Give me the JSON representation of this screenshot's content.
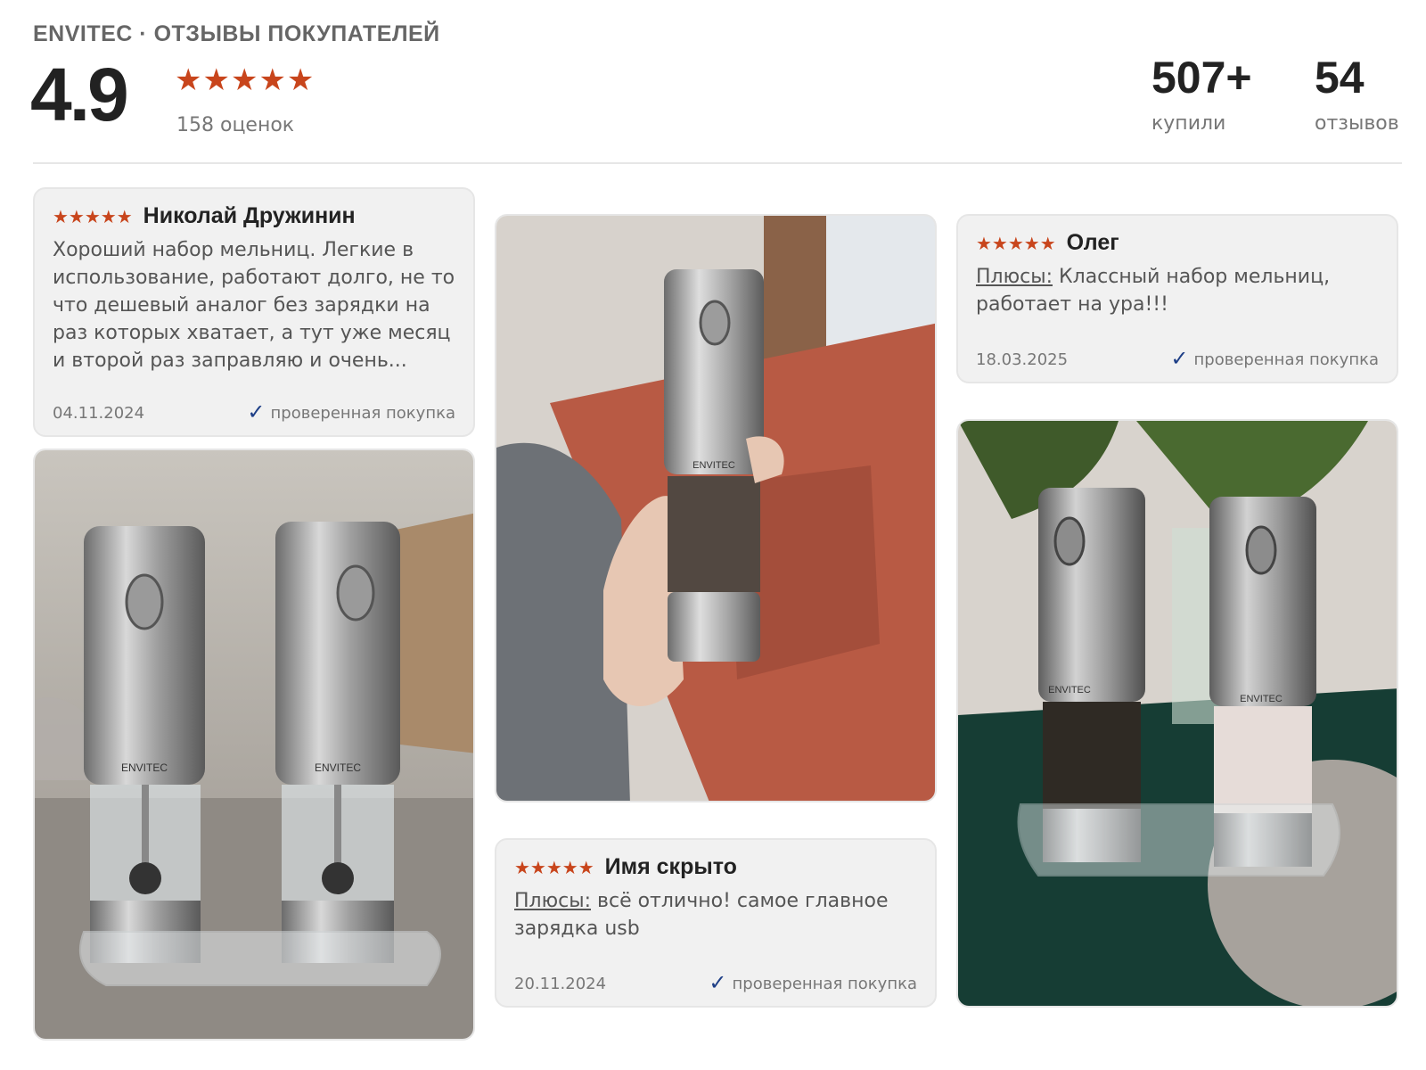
{
  "header": {
    "title": "ENVITEC · ОТЗЫВЫ ПОКУПАТЕЛЕЙ",
    "score": "4.9",
    "stars": "★★★★★",
    "ratings_count": "158 оценок",
    "stats": [
      {
        "value": "507+",
        "label": "купили"
      },
      {
        "value": "54",
        "label": "отзывов"
      }
    ]
  },
  "reviews": [
    {
      "stars": "★★★★★",
      "author": "Николай Дружинин",
      "text": "Хороший набор мельниц. Легкие в использование, работают долго, не то что дешевый аналог без зарядки на раз которых хватает, а тут уже месяц и второй раз заправляю и очень...",
      "date": "04.11.2024",
      "verified": "проверенная покупка"
    },
    {
      "stars": "★★★★★",
      "author": "Олег",
      "pros_label": "Плюсы:",
      "text": " Классный набор мельниц, работает на ура!!!",
      "date": "18.03.2025",
      "verified": "проверенная покупка"
    },
    {
      "stars": "★★★★★",
      "author": "Имя скрыто",
      "pros_label": "Плюсы:",
      "text": " всё отлично! самое главное зарядка usb",
      "date": "20.11.2024",
      "verified": "проверенная покупка"
    }
  ],
  "photo_brand": "ENVITEC",
  "icons": {
    "check": "check-icon",
    "star": "star-icon"
  },
  "colors": {
    "star": "#c8451c",
    "check": "#1e3f87"
  }
}
